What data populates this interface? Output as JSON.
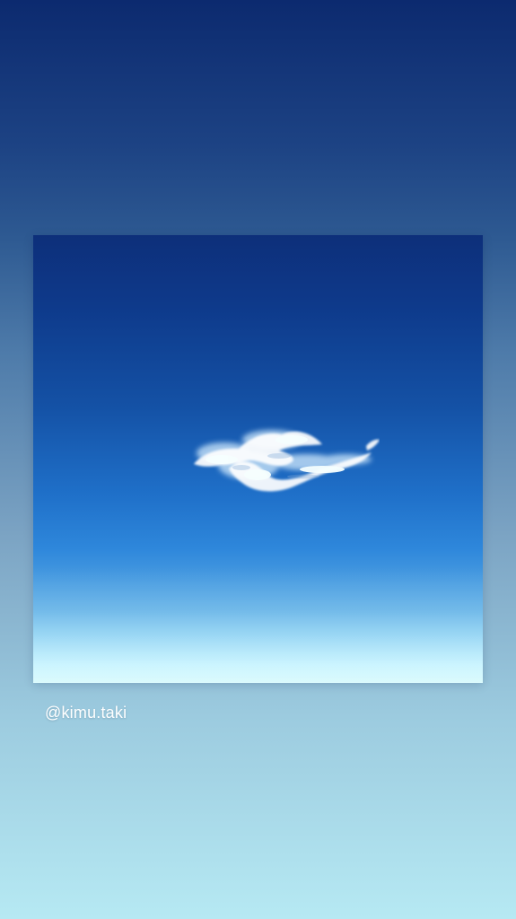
{
  "story": {
    "credit_handle": "@kimu.taki"
  },
  "photo": {
    "subject": "cloud-in-blue-sky"
  },
  "colors": {
    "background_top": "#0c2a6f",
    "background_bottom": "#b6e9f3",
    "sky_top": "#0d2f7a",
    "sky_bottom": "#c8f7fb",
    "cloud": "#ffffff"
  }
}
